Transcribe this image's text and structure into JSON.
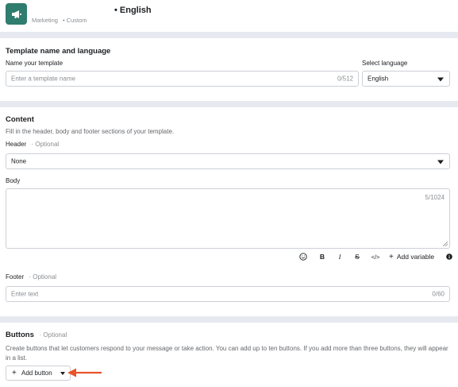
{
  "header": {
    "title": "• English",
    "tags": [
      "Marketing",
      "• Custom"
    ],
    "logo_icon": "megaphone-icon",
    "logo_color": "#2e7d6e"
  },
  "template_section": {
    "title": "Template name and language",
    "name_label": "Name your template",
    "name_placeholder": "Enter a template name",
    "name_count": "0/512",
    "language_label": "Select language",
    "language_value": "English"
  },
  "content_section": {
    "title": "Content",
    "help": "Fill in the header, body and footer sections of your template.",
    "header_label": "Header",
    "header_optional": "· Optional",
    "header_value": "None",
    "body_label": "Body",
    "body_count": "5/1024",
    "toolbar": {
      "emoji_icon": "emoji-icon",
      "bold": "B",
      "italic": "I",
      "strike": "S",
      "code": "</>",
      "add_variable": "Add variable",
      "plus": "+",
      "info_icon": "info-icon"
    },
    "footer_label": "Footer",
    "footer_optional": "· Optional",
    "footer_placeholder": "Enter text",
    "footer_count": "0/60"
  },
  "buttons_section": {
    "title": "Buttons",
    "optional": "· Optional",
    "help": "Create buttons that let customers respond to your message or take action. You can add up to ten buttons. If you add more than three buttons, they will appear in a list.",
    "add_button_label": "Add button",
    "add_plus": "+",
    "arrow_color": "#e8552b"
  }
}
